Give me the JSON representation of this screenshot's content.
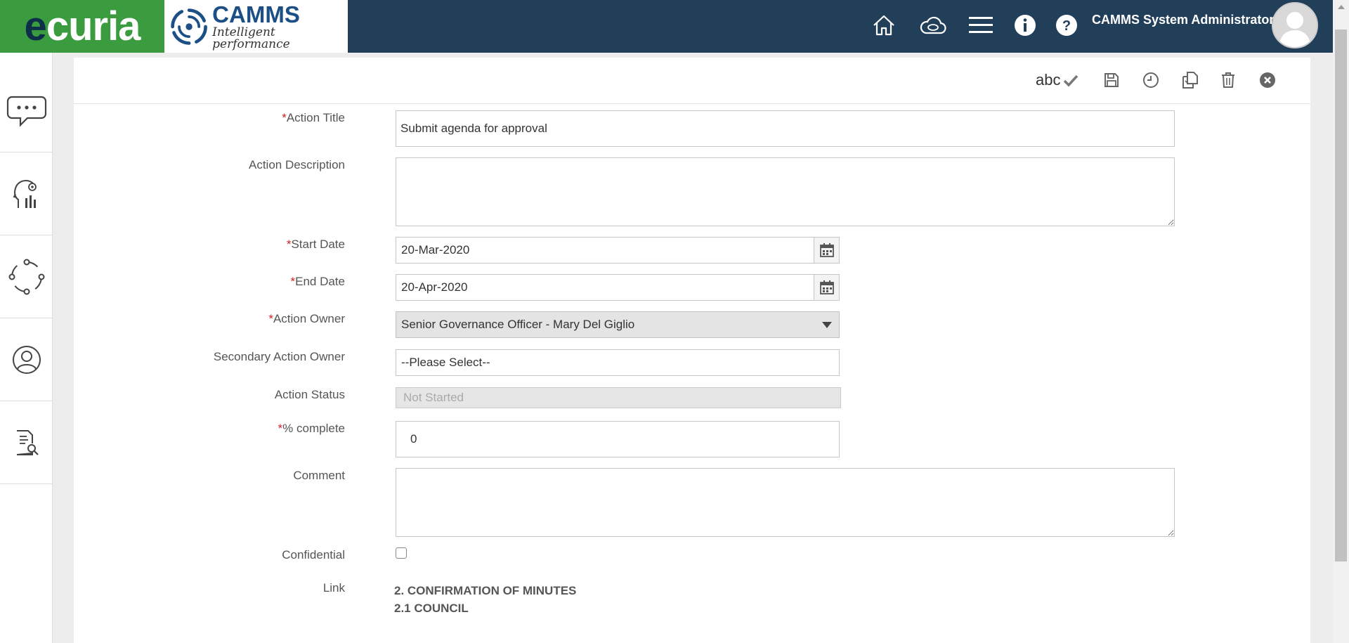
{
  "header": {
    "brand_ecuria_e": "e",
    "brand_ecuria_rest": "curia",
    "brand_camms": "CAMMS",
    "brand_tagline": "Intelligent performance",
    "user_name": "CAMMS System Administrator",
    "icons": [
      "home-icon",
      "cloud-sync-icon",
      "menu-icon",
      "info-icon",
      "help-icon"
    ]
  },
  "sidebar": {
    "items": [
      {
        "icon": "chat-icon"
      },
      {
        "icon": "settings-head-icon"
      },
      {
        "icon": "cycle-icon"
      },
      {
        "icon": "user-icon"
      },
      {
        "icon": "document-search-icon"
      }
    ]
  },
  "toolbar": {
    "spell_label": "abc",
    "icons": [
      "spell-check-icon",
      "save-icon",
      "history-icon",
      "copy-icon",
      "delete-icon",
      "close-icon"
    ]
  },
  "form": {
    "title_label": "Action Title",
    "title_value": "Submit agenda for approval",
    "description_label": "Action Description",
    "description_value": "",
    "start_label": "Start Date",
    "start_value": "20-Mar-2020",
    "end_label": "End Date",
    "end_value": "20-Apr-2020",
    "owner_label": "Action Owner",
    "owner_value": "Senior Governance Officer - Mary Del Giglio",
    "secondary_label": "Secondary Action Owner",
    "secondary_value": "--Please Select--",
    "status_label": "Action Status",
    "status_value": "Not Started",
    "percent_label": "% complete",
    "percent_value": "0",
    "comment_label": "Comment",
    "comment_value": "",
    "confidential_label": "Confidential",
    "link_label": "Link",
    "links": [
      "2. CONFIRMATION OF MINUTES",
      "2.1 COUNCIL"
    ],
    "required_mark": "*"
  },
  "colors": {
    "header_bg": "#223f5a",
    "ecuria_green": "#3a9b3f",
    "required": "#d42020"
  }
}
